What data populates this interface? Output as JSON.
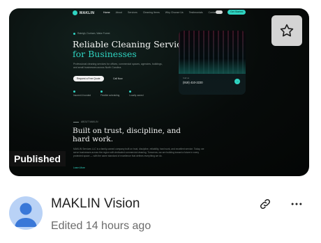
{
  "thumbnail": {
    "site": {
      "logo_text": "MAKLIN",
      "nav_links": [
        "Home",
        "About",
        "Services",
        "Cleaning Items",
        "Why Choose Us",
        "Testimonials",
        "Contact"
      ],
      "nav_cta": "Get Started",
      "hero": {
        "kicker": "Raleigh, Durham, Wake Forest",
        "title": "Reliable Cleaning Services",
        "title_accent": "for Businesses",
        "description": "Professional cleaning services for offices, commercial spaces, agencies, buildings, and small businesses across North Carolina.",
        "primary_button": "Request a Free Quote",
        "secondary_button": "Call Now",
        "stats": [
          "Insured & bonded",
          "Flexible scheduling",
          "Locally owned"
        ]
      },
      "image_card": {
        "label": "Call us",
        "phone": "(919) 410-2220"
      },
      "about": {
        "kicker": "ABOUT MAKLIN",
        "title": "Built on trust, discipline, and hard work.",
        "text": "MAKLIN Services LLC is a family-owned company built on trust, discipline, reliability, hard work, and excellent service. Today, we serve businesses across the region with dedicated commercial cleaning. Tomorrow, we are building toward a future in every protected space — with the same standard of excellence that defines everything we do.",
        "more_link": "Learn More"
      }
    },
    "published_badge": "Published"
  },
  "project": {
    "title": "MAKLIN Vision",
    "meta": "Edited 14 hours ago"
  },
  "icons": {
    "star": "star-icon",
    "link": "link-icon",
    "more": "more-horizontal-icon",
    "avatar": "user-avatar-icon"
  },
  "colors": {
    "accent": "#2fd4c2",
    "avatar_bg": "#b9d2f6",
    "avatar_fg": "#3a78d8"
  }
}
